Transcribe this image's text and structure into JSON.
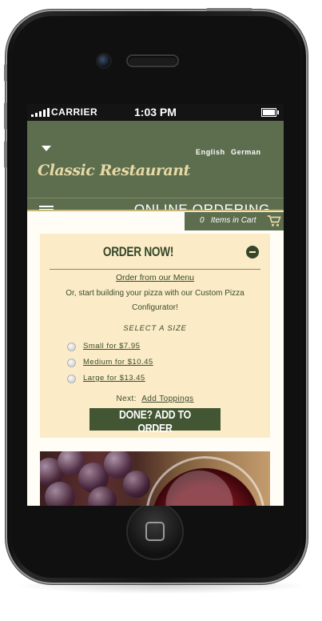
{
  "status_bar": {
    "carrier": "CARRIER",
    "time": "1:03 PM"
  },
  "header": {
    "languages": [
      "English",
      "German"
    ],
    "logo_text": "Classic Restaurant",
    "title": "ONLINE ORDERING"
  },
  "cart": {
    "count": "0",
    "label": "Items in Cart",
    "icon": "shopping-cart-icon"
  },
  "order": {
    "title": "ORDER NOW!",
    "toggle_icon": "minus-circle-icon",
    "menu_link": "Order from our Menu",
    "start_text": "Or, start building your pizza with our Custom Pizza Configurator!",
    "select_size_label": "SELECT A SIZE",
    "sizes": [
      {
        "label": "Small  for  $7.95"
      },
      {
        "label": "Medium  for  $10.45"
      },
      {
        "label": "Large  for  $13.45"
      }
    ],
    "next_label": "Next:",
    "next_link": "Add Toppings",
    "done_button": "DONE? ADD TO ORDER"
  },
  "image": {
    "subject": "grapes-and-wine-glass"
  },
  "colors": {
    "header_green": "#5d6e4e",
    "panel_cream": "#fbecc7",
    "button_green": "#435633",
    "logo_gold": "#e7d9a6"
  }
}
